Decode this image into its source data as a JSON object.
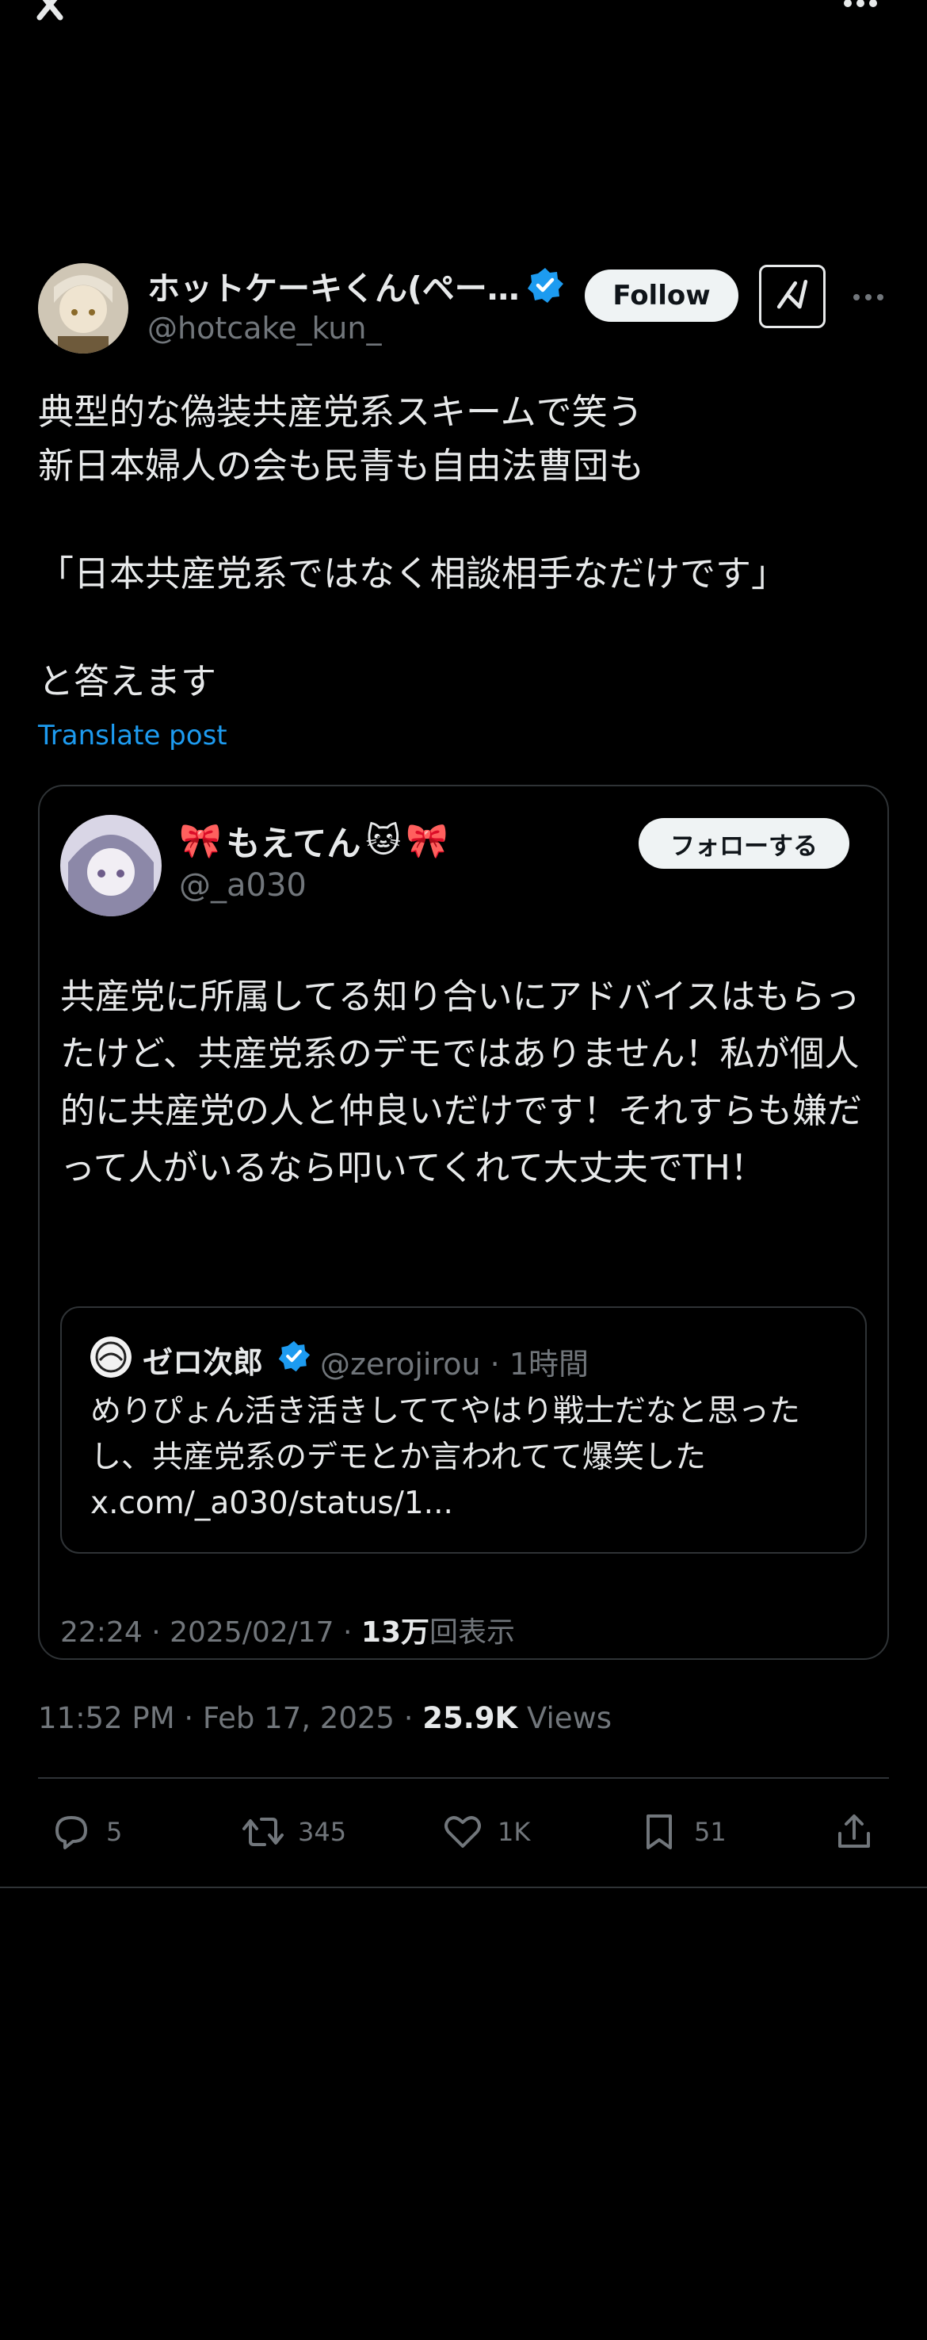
{
  "topbar": {
    "logo": "x-logo-icon",
    "more": "more-icon"
  },
  "author": {
    "name": "ホットケーキくん(ペー…",
    "handle": "@hotcake_kun_",
    "follow_label": "Follow"
  },
  "tweet": {
    "text": "典型的な偽装共産党系スキームで笑う\n新日本婦人の会も民青も自由法曹団も\n\n「日本共産党系ではなく相談相手なだけです」\n\nと答えます",
    "translate_label": "Translate post",
    "time": "11:52 PM · Feb 17, 2025 · ",
    "views_count": "25.9K",
    "views_label": "Views"
  },
  "quote": {
    "name": "もえてん",
    "emoji_left": "🎀",
    "emoji_cat": "🐱",
    "emoji_right": "🎀",
    "handle": "@_a030",
    "follow_label": "フォローする",
    "text": "共産党に所属してる知り合いにアドバイスはもらったけど、共産党系のデモではありません！私が個人的に共産党の人と仲良いだけです！それすらも嫌だって人がいるなら叩いてくれて大丈夫でTH！",
    "meta_time": "22:24 · 2025/02/17 · ",
    "meta_views": "13万",
    "meta_views_label": "回表示"
  },
  "nested_quote": {
    "name": "ゼロ次郎",
    "handle": "@zerojirou · 1時間",
    "text": "めりぴょん活き活きしててやはり戦士だなと思ったし、共産党系のデモとか言われてて爆笑した x.com/_a030/status/1..."
  },
  "actions": {
    "reply_count": "5",
    "retweet_count": "345",
    "like_count": "1K",
    "bookmark_count": "51"
  },
  "colors": {
    "background": "#000000",
    "text": "#e7e9ea",
    "muted": "#71767b",
    "accent": "#1d9bf0",
    "border": "#2f3336"
  }
}
